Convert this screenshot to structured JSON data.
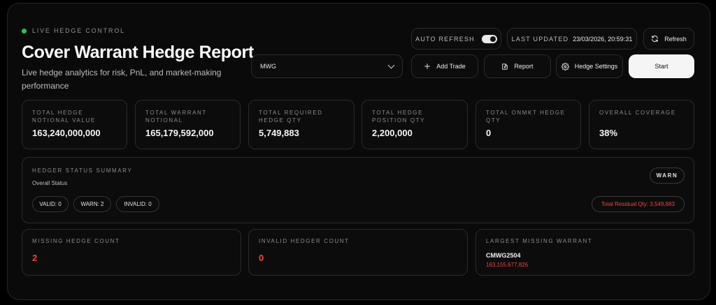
{
  "header": {
    "live_label": "LIVE HEDGE CONTROL",
    "title": "Cover Warrant Hedge Report",
    "subtitle": "Live hedge analytics for risk, PnL, and market-making performance",
    "live_color": "#22c55e"
  },
  "symbol_select": {
    "value": "MWG"
  },
  "toolbar": {
    "auto_refresh_label": "AUTO REFRESH",
    "auto_refresh_on": true,
    "last_updated_label": "LAST UPDATED",
    "last_updated_value": "23/03/2026, 20:59:31",
    "refresh_label": "Refresh",
    "add_trade_label": "Add Trade",
    "report_label": "Report",
    "hedge_settings_label": "Hedge Settings",
    "start_label": "Start"
  },
  "kpis": [
    {
      "label": "TOTAL HEDGE NOTIONAL VALUE",
      "value": "163,240,000,000"
    },
    {
      "label": "TOTAL WARRANT NOTIONAL",
      "value": "165,179,592,000"
    },
    {
      "label": "TOTAL REQUIRED HEDGE QTY",
      "value": "5,749,883"
    },
    {
      "label": "TOTAL HEDGE POSITION QTY",
      "value": "2,200,000"
    },
    {
      "label": "TOTAL ONMKT HEDGE QTY",
      "value": "0"
    },
    {
      "label": "OVERALL COVERAGE",
      "value": "38%"
    }
  ],
  "status_summary": {
    "label": "HEDGER STATUS SUMMARY",
    "sub": "Overall Status",
    "valid": "VALID: 0",
    "warn": "WARN: 2",
    "invalid": "INVALID: 0",
    "badge": "WARN",
    "residual": "Total Residual Qty: 3,549,883",
    "alert_color": "#ef4444"
  },
  "bottom": {
    "missing_label": "MISSING HEDGE COUNT",
    "missing_value": "2",
    "invalid_label": "INVALID HEDGER COUNT",
    "invalid_value": "0",
    "largest_label": "LARGEST MISSING WARRANT",
    "largest_name": "CMWG2504",
    "largest_value": "163,155,677,826"
  },
  "icons": [
    "plus-icon",
    "report-icon",
    "gear-icon",
    "refresh-icon",
    "chevron-down-icon"
  ]
}
